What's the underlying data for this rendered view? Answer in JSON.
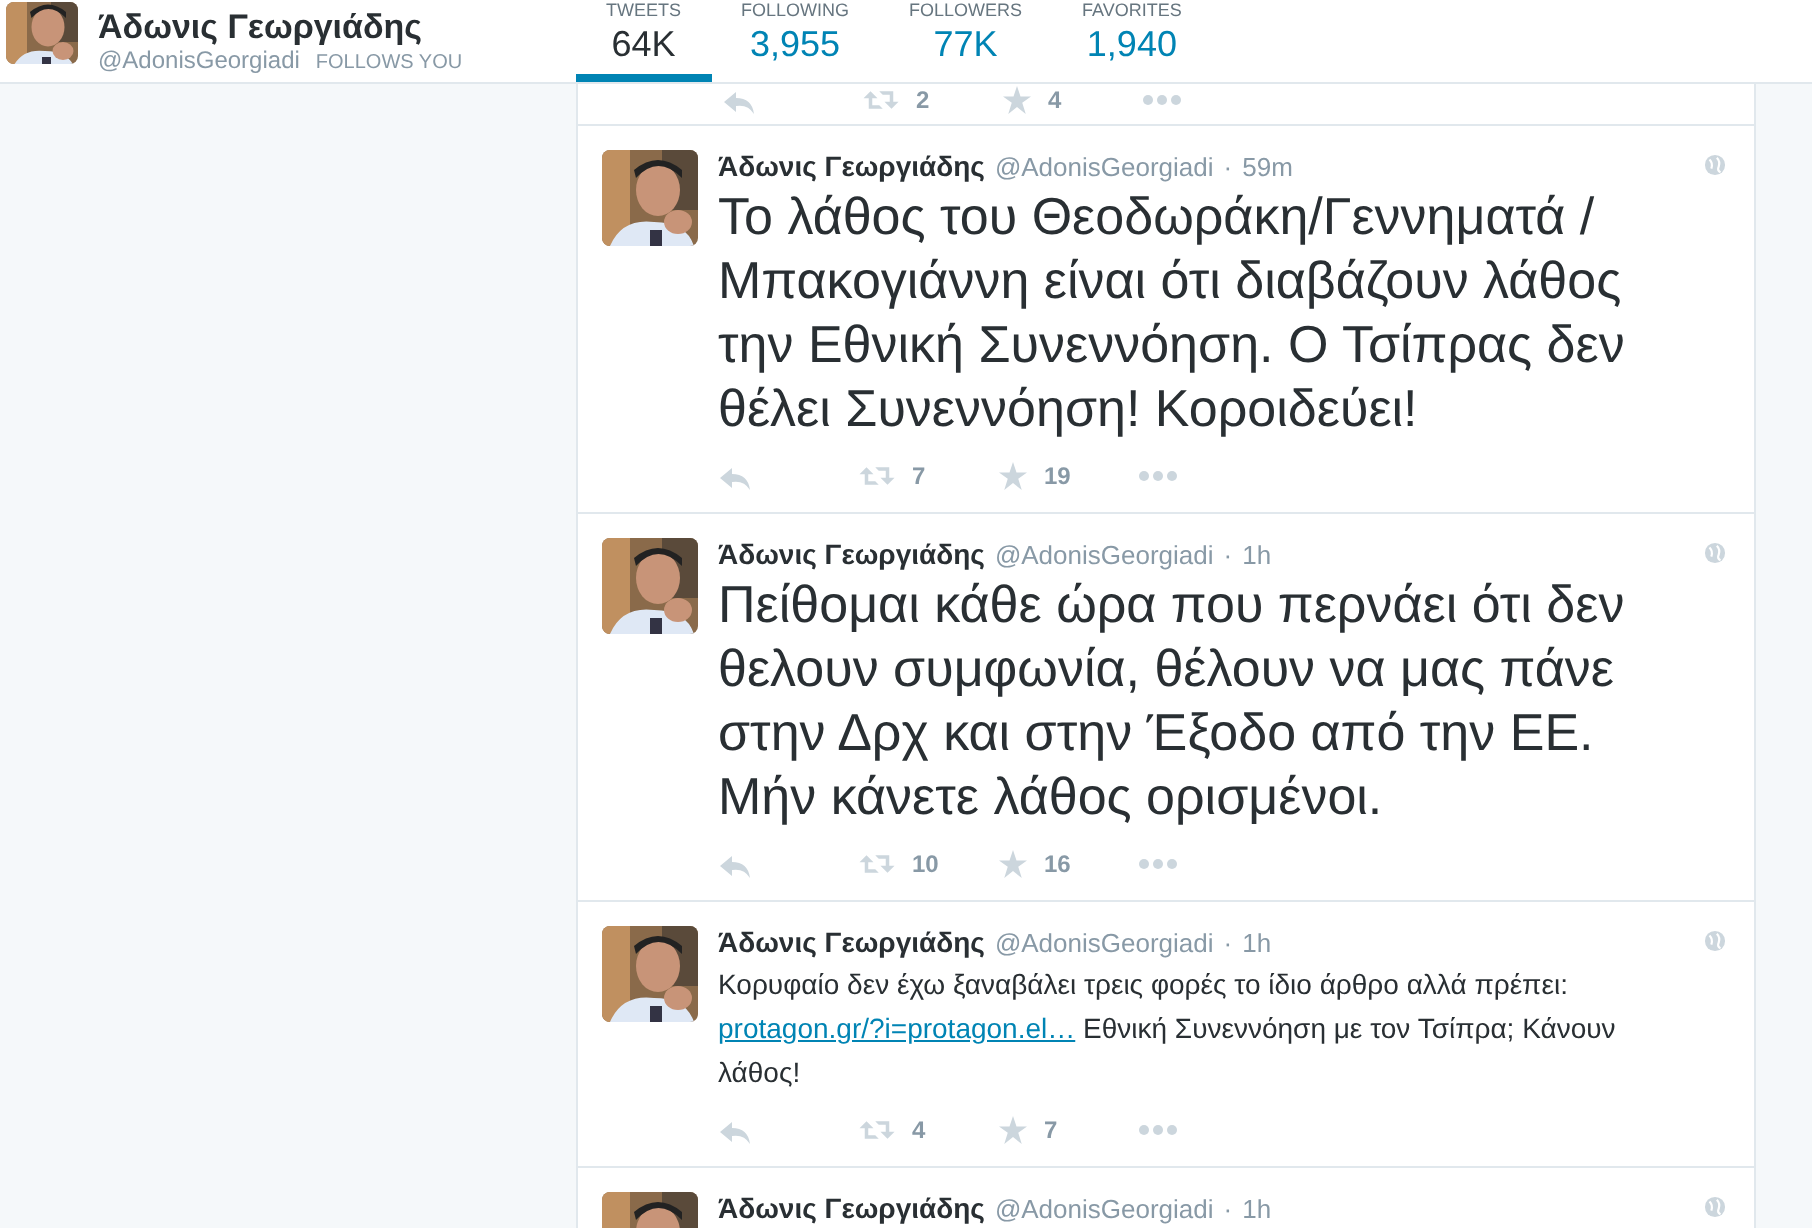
{
  "profile": {
    "name": "Άδωνις Γεωργιάδης",
    "handle": "@AdonisGeorgiadi",
    "follows_you": "FOLLOWS YOU"
  },
  "stats": [
    {
      "label": "TWEETS",
      "value": "64K",
      "selected": true
    },
    {
      "label": "FOLLOWING",
      "value": "3,955",
      "selected": false
    },
    {
      "label": "FOLLOWERS",
      "value": "77K",
      "selected": false
    },
    {
      "label": "FAVORITES",
      "value": "1,940",
      "selected": false
    }
  ],
  "partial_actions": {
    "retweets": "2",
    "favorites": "4"
  },
  "tweets": [
    {
      "name": "Άδωνις Γεωργιάδης",
      "handle": "@AdonisGeorgiadi",
      "separator": "·",
      "time": "59m",
      "kind": "large",
      "text": "Το λάθος του Θεοδωράκη/Γεννηματά /Μπακογιάννη είναι ότι διαβάζουν λάθος την Εθνική Συνεννόηση. Ο Τσίπρας δεν θέλει Συνεννόηση! Κοροιδεύει!",
      "retweets": "7",
      "favorites": "19"
    },
    {
      "name": "Άδωνις Γεωργιάδης",
      "handle": "@AdonisGeorgiadi",
      "separator": "·",
      "time": "1h",
      "kind": "large",
      "text": "Πείθομαι κάθε ώρα που περνάει ότι δεν θελουν συμφωνία, θέλουν να μας πάνε στην Δρχ και στην Έξοδο από την ΕΕ. Μήν κάνετε λάθος ορισμένοι.",
      "retweets": "10",
      "favorites": "16"
    },
    {
      "name": "Άδωνις Γεωργιάδης",
      "handle": "@AdonisGeorgiadi",
      "separator": "·",
      "time": "1h",
      "kind": "normal",
      "text": "Κορυφαίο δεν έχω ξαναβάλει τρεις φορές το ίδιο άρθρο αλλά πρέπει:",
      "link": "protagon.gr/?i=protagon.el…",
      "text_after": "Εθνική Συνεννόηση με τον Τσίπρα; Κάνουν λάθος!",
      "retweets": "4",
      "favorites": "7"
    },
    {
      "name": "Άδωνις Γεωργιάδης",
      "handle": "@AdonisGeorgiadi",
      "separator": "·",
      "time": "1h",
      "kind": "cut"
    }
  ]
}
